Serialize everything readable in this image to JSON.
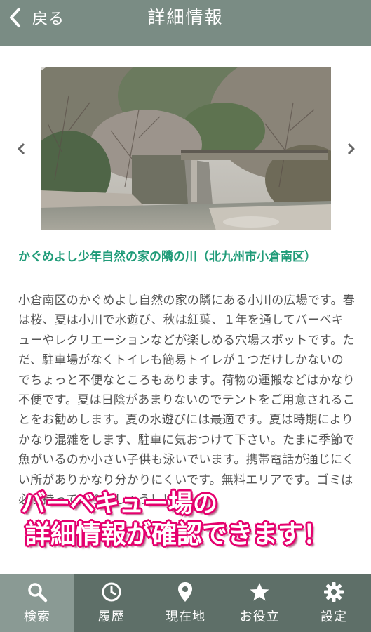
{
  "header": {
    "back_label": "戻る",
    "title": "詳細情報"
  },
  "spot": {
    "title": "かぐめよし少年自然の家の隣の川（北九州市小倉南区）",
    "description": "小倉南区のかぐめよし自然の家の隣にある小川の広場です。春は桜、夏は小川で水遊び、秋は紅葉、１年を通してバーベキューやレクリエーションなどが楽しめる穴場スポットです。ただ、駐車場がなくトイレも簡易トイレが１つだけしかないのでちょっと不便なところもあります。荷物の運搬などはかなり不便です。夏は日陰があまりないのでテントをご用意されることをお勧めします。夏の水遊びには最適です。夏は時期によりかなり混雑をします、駐車に気おつけて下さい。たまに季節で魚がいるのか小さい子供も泳いでいます。携帯電話が通じにくい所がありかなり分かりにくいです。無料エリアです。ゴミは必ず持って帰りましょう！！"
  },
  "banner": {
    "line1": "バーベキュー場の",
    "line2": "詳細情報が確認できます！"
  },
  "tabs": [
    {
      "label": "検索",
      "icon": "search-icon",
      "active": true
    },
    {
      "label": "履歴",
      "icon": "clock-icon",
      "active": false
    },
    {
      "label": "現在地",
      "icon": "location-pin-icon",
      "active": false
    },
    {
      "label": "お役立",
      "icon": "star-icon",
      "active": false
    },
    {
      "label": "設定",
      "icon": "gear-icon",
      "active": false
    }
  ],
  "colors": {
    "header_bg": "#7a8c84",
    "tabbar_bg": "#5e6f68",
    "tab_active_bg": "#8a9a94",
    "title_green": "#1f9b78",
    "banner_pink": "#e5006e"
  }
}
